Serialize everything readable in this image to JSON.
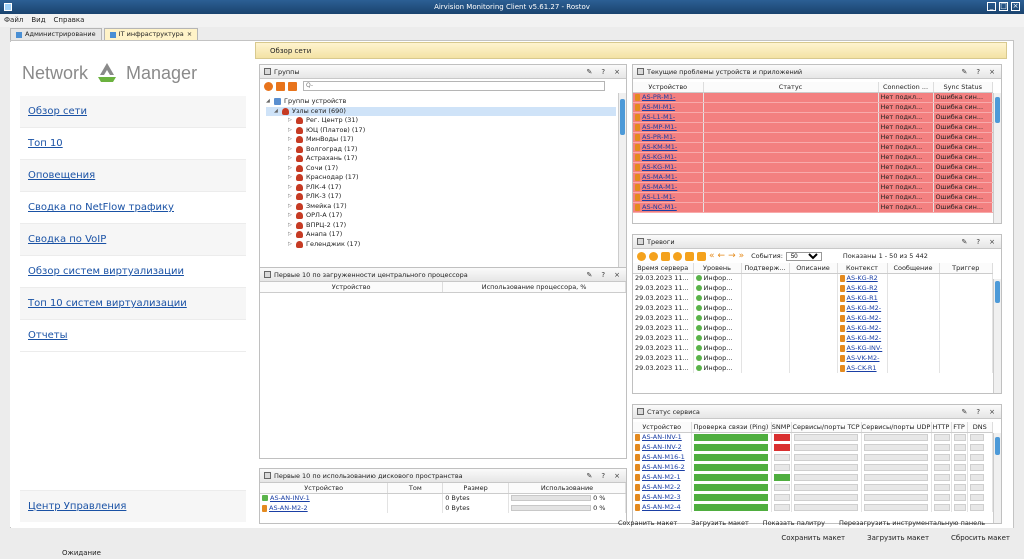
{
  "window": {
    "title": "Airvision Monitoring Client v5.61.27 - Rostov"
  },
  "menu": [
    "Файл",
    "Вид",
    "Справка"
  ],
  "tabs": [
    {
      "label": "Администрирование",
      "active": false
    },
    {
      "label": "IT инфраструктура",
      "active": true,
      "close": "×"
    }
  ],
  "sidebar": {
    "logo_left": "Network",
    "logo_right": "Manager",
    "items": [
      "Обзор сети",
      "Топ 10",
      "Оповещения",
      "Сводка по NetFlow трафику",
      "Сводка по VoIP",
      "Обзор систем виртуализации",
      "Топ 10 систем виртуализации",
      "Отчеты"
    ],
    "bottom": "Центр Управления"
  },
  "overview_title": "Обзор сети",
  "panel_controls": {
    "edit": "✎",
    "help": "?",
    "close": "×"
  },
  "groups": {
    "title": "Группы",
    "search_placeholder": "Q-",
    "root": "Группы устройств",
    "node": "Узлы сети (690)",
    "children": [
      "Рег. Центр (31)",
      "ЮЦ (Платов) (17)",
      "МинВоды (17)",
      "Волгоград (17)",
      "Астрахань (17)",
      "Сочи (17)",
      "Краснодар (17)",
      "РЛК-4  (17)",
      "РЛК-3 (17)",
      "Змейка (17)",
      "ОРЛ-А (17)",
      "ВПРЦ-2  (17)",
      "Анапа (17)",
      "Геленджик (17)"
    ]
  },
  "cpu_panel": {
    "title": "Первые 10 по загруженности центрального процессора",
    "columns": [
      "Устройство",
      "Использование процессора, %"
    ]
  },
  "disk_panel": {
    "title": "Первые 10 по использованию дискового пространства",
    "columns": [
      "Устройство",
      "Том",
      "Размер",
      "Использование"
    ],
    "rows": [
      {
        "device": "AS-AN-INV-1",
        "volume": "",
        "size": "0 Bytes",
        "usage": "0 %",
        "usage_pct": 0
      },
      {
        "device": "AS-AN-M2-2",
        "volume": "",
        "size": "0 Bytes",
        "usage": "0 %",
        "usage_pct": 0
      }
    ]
  },
  "problems": {
    "title": "Текущие проблемы устройств и приложений",
    "columns": [
      "Устройство",
      "Статус",
      "Connection ...",
      "Sync Status"
    ],
    "rows": [
      {
        "device": "AS-PR-M1-",
        "conn": "Нет подкл...",
        "sync": "Ошибка син..."
      },
      {
        "device": "AS-MI-M1-",
        "conn": "Нет подкл...",
        "sync": "Ошибка син..."
      },
      {
        "device": "AS-L1-M1-",
        "conn": "Нет подкл...",
        "sync": "Ошибка син..."
      },
      {
        "device": "AS-MP-M1-",
        "conn": "Нет подкл...",
        "sync": "Ошибка син..."
      },
      {
        "device": "AS-PR-M1-",
        "conn": "Нет подкл...",
        "sync": "Ошибка син..."
      },
      {
        "device": "AS-KM-M1-",
        "conn": "Нет подкл...",
        "sync": "Ошибка син..."
      },
      {
        "device": "AS-KG-M1-",
        "conn": "Нет подкл...",
        "sync": "Ошибка син..."
      },
      {
        "device": "AS-KG-M1-",
        "conn": "Нет подкл...",
        "sync": "Ошибка син..."
      },
      {
        "device": "AS-MA-M1-",
        "conn": "Нет подкл...",
        "sync": "Ошибка син..."
      },
      {
        "device": "AS-MA-M1-",
        "conn": "Нет подкл...",
        "sync": "Ошибка син..."
      },
      {
        "device": "AS-L1-M1-",
        "conn": "Нет подкл...",
        "sync": "Ошибка син..."
      },
      {
        "device": "AS-NC-M1-",
        "conn": "Нет подкл...",
        "sync": "Ошибка син..."
      }
    ]
  },
  "alarms": {
    "title": "Тревоги",
    "events_label": "События:",
    "events_value": "50",
    "shown": "Показаны 1 - 50 из 5 442",
    "columns": [
      "Время сервера",
      "Уровень",
      "Подтверж...",
      "Описание",
      "Контекст",
      "Сообщение",
      "Триггер"
    ],
    "rows": [
      {
        "time": "29.03.2023 11...",
        "level": "Инфор...",
        "context": "AS-KG-R2"
      },
      {
        "time": "29.03.2023 11...",
        "level": "Инфор...",
        "context": "AS-KG-R2"
      },
      {
        "time": "29.03.2023 11...",
        "level": "Инфор...",
        "context": "AS-KG-R1"
      },
      {
        "time": "29.03.2023 11...",
        "level": "Инфор...",
        "context": "AS-KG-M2-"
      },
      {
        "time": "29.03.2023 11...",
        "level": "Инфор...",
        "context": "AS-KG-M2-"
      },
      {
        "time": "29.03.2023 11...",
        "level": "Инфор...",
        "context": "AS-KG-M2-"
      },
      {
        "time": "29.03.2023 11...",
        "level": "Инфор...",
        "context": "AS-KG-M2-"
      },
      {
        "time": "29.03.2023 11...",
        "level": "Инфор...",
        "context": "AS-KG-INV-"
      },
      {
        "time": "29.03.2023 11...",
        "level": "Инфор...",
        "context": "AS-VK-M2-"
      },
      {
        "time": "29.03.2023 11...",
        "level": "Инфор...",
        "context": "AS-CK-R1"
      }
    ]
  },
  "service": {
    "title": "Статус сервиса",
    "columns": [
      "Устройство",
      "Проверка связи (Ping)",
      "SNMP",
      "Сервисы/порты TCP",
      "Сервисы/порты UDP",
      "HTTP",
      "FTP",
      "DNS"
    ],
    "rows": [
      {
        "device": "AS-AN-INV-1",
        "ping": "green",
        "snmp": "red"
      },
      {
        "device": "AS-AN-INV-2",
        "ping": "green",
        "snmp": "red"
      },
      {
        "device": "AS-AN-M16-1",
        "ping": "green",
        "snmp": "gray"
      },
      {
        "device": "AS-AN-M16-2",
        "ping": "green",
        "snmp": "gray"
      },
      {
        "device": "AS-AN-M2-1",
        "ping": "green",
        "snmp": "green"
      },
      {
        "device": "AS-AN-M2-2",
        "ping": "green",
        "snmp": "gray"
      },
      {
        "device": "AS-AN-M2-3",
        "ping": "green",
        "snmp": "gray"
      },
      {
        "device": "AS-AN-M2-4",
        "ping": "green",
        "snmp": "gray"
      }
    ]
  },
  "layout_actions": [
    "Сохранить макет",
    "Загрузить макет",
    "Показать палитру",
    "Перезагрузить инструментальную панель"
  ],
  "status_buttons": [
    "Сохранить макет",
    "Загрузить макет",
    "Сбросить макет"
  ],
  "status_text": "Ожидание",
  "colors": {
    "problem_row": "#f38080",
    "link": "#1a52a5",
    "accent": "#2c5f94"
  }
}
